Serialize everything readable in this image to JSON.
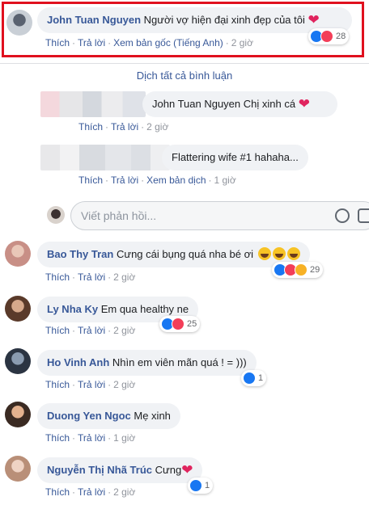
{
  "comments": [
    {
      "author": "John Tuan Nguyen",
      "text": "Người vợ hiện đại xinh đẹp của tôi",
      "like": "Thích",
      "reply": "Trả lời",
      "extra": "Xem bản gốc (Tiếng Anh)",
      "time": "2 giờ",
      "reaction_count": "28"
    },
    {
      "author": "Bao Thy Tran",
      "text": "Cưng cái bụng quá nha bé ơi",
      "like": "Thích",
      "reply": "Trả lời",
      "time": "2 giờ",
      "reaction_count": "29"
    },
    {
      "author": "Ly Nha Ky",
      "text": "Em qua healthy ne",
      "like": "Thích",
      "reply": "Trả lời",
      "time": "2 giờ",
      "reaction_count": "25"
    },
    {
      "author": "Ho Vinh Anh",
      "text": "Nhìn em viên mãn quá ! = )))",
      "like": "Thích",
      "reply": "Trả lời",
      "time": "2 giờ",
      "reaction_count": "1"
    },
    {
      "author": "Duong Yen Ngoc",
      "text": "Mẹ xinh",
      "like": "Thích",
      "reply": "Trả lời",
      "time": "1 giờ"
    },
    {
      "author": "Nguyễn Thị Nhã Trúc",
      "text": "Cưng",
      "like": "Thích",
      "reply": "Trả lời",
      "time": "2 giờ",
      "reaction_count": "1"
    }
  ],
  "translate_all": "Dịch tất cả bình luận",
  "replies": [
    {
      "text": "John Tuan Nguyen Chị xinh cá",
      "like": "Thích",
      "reply": "Trả lời",
      "time": "2 giờ"
    },
    {
      "text": "Flattering wife #1 hahaha...",
      "like": "Thích",
      "reply": "Trả lời",
      "extra": "Xem bản dịch",
      "time": "1 giờ"
    }
  ],
  "reply_box": {
    "placeholder": "Viết phản hồi..."
  },
  "colors": {
    "link": "#385898",
    "highlight": "#e0101e",
    "bubble": "#f0f2f5",
    "like": "#1877f2",
    "love": "#f33e58",
    "haha": "#f7b125"
  }
}
